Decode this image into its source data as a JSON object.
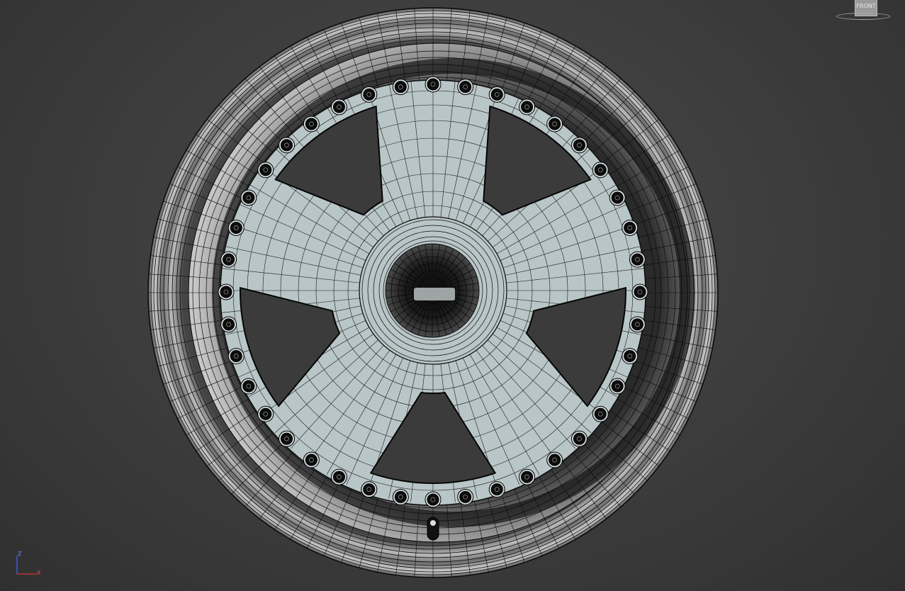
{
  "viewport": {
    "view_label": "FRONT",
    "axis": {
      "z_label": "Z",
      "x_label": "X"
    }
  },
  "colors": {
    "background": "#3c3c3c",
    "wireframe": "#0a0a0a",
    "spoke_surface": "#b9c6c7",
    "rim_light": "#9c9c9c",
    "rim_dark": "#1a1a1a",
    "axis_x": "#c23030",
    "axis_z": "#3a5bd8"
  },
  "model": {
    "spoke_count": 5,
    "bolt_count": 40
  }
}
